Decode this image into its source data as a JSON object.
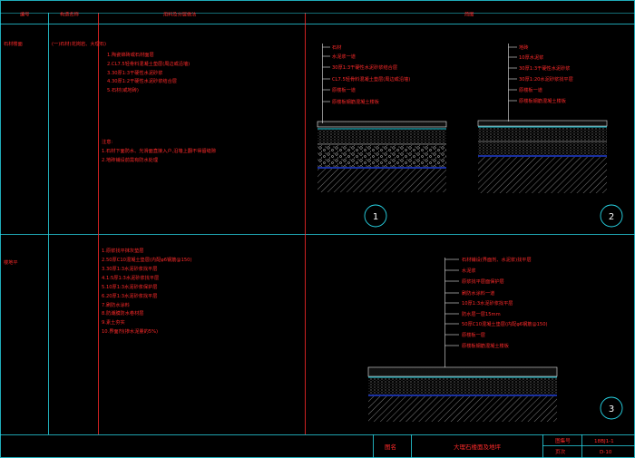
{
  "header": {
    "col_number": "编号",
    "col_name": "构造名称",
    "col_spec": "用料及分层做法",
    "col_figure": "简图"
  },
  "rows": [
    {
      "code": "石材楼面",
      "name": "(一)石材(花岗岩、大理石)",
      "steps": [
        "1.陶瓷锦砖或石材面层",
        "2.CL7.5轻骨料混凝土垫层(周边或沿墙)",
        "3.30厚1:3干硬性水泥砂浆",
        "4.30厚1:2干硬性水泥砂浆结合层",
        "5.石材(或地砖)"
      ],
      "notes": [
        "注意:",
        "1.石材下面防水、光滑面直接入户,沿墙上翻不得留缝隙",
        "2.地砖铺设前需有防水处理"
      ]
    },
    {
      "code": "楼地平",
      "name": "",
      "steps": [
        "1.原浆找平抹灰垫层",
        "2.50厚C10混凝土垫层(内配φ6钢筋@150)",
        "3.30厚1:3水泥砂浆找平层",
        "4.1:5厚1:3水泥砂浆找平层",
        "5.10厚1:3水泥砂浆保护层",
        "6.20厚1:3水泥砂浆找平层",
        "7.刷防水涂料",
        "8.防潮膜防水卷材层",
        "9.素土夯实",
        "10.界面剂(掺水泥量的5%)"
      ]
    }
  ],
  "figures": [
    {
      "number": "1",
      "labels": [
        "石材",
        "水泥浆一道",
        "30厚1:3干硬性水泥砂浆结合层",
        "CL7.5轻骨料混凝土垫层(周边或沿墙)",
        "原楼板一道",
        "原楼板钢筋混凝土楼板"
      ]
    },
    {
      "number": "2",
      "labels": [
        "地砖",
        "10厚水泥浆",
        "30厚1:3干硬性水泥砂浆",
        "30厚1:20水泥砂浆找平层",
        "原楼板一道",
        "原楼板钢筋混凝土楼板"
      ]
    },
    {
      "number": "3",
      "labels": [
        "石材铺设(界面剂、水泥浆)找平层",
        "水泥浆",
        "原浆找平层面保护层",
        "刷防水涂料一道",
        "10厚1:3水泥砂浆找平层",
        "防水层一层15mm",
        "50厚C10混凝土垫层(内配φ6钢筋@150)",
        "原楼板一层",
        "原楼板钢筋混凝土楼板"
      ]
    }
  ],
  "title_block": {
    "label_name": "图名",
    "drawing_name": "大理石楼面及地坪",
    "label_atlas": "图集号",
    "atlas_no": "18BJ1-1",
    "label_page": "页次",
    "page_no": "D-10"
  },
  "colors": {
    "background": "#000000",
    "frame": "#28d7e8",
    "text": "#ff2a2a",
    "accent": "#2a4dff"
  }
}
